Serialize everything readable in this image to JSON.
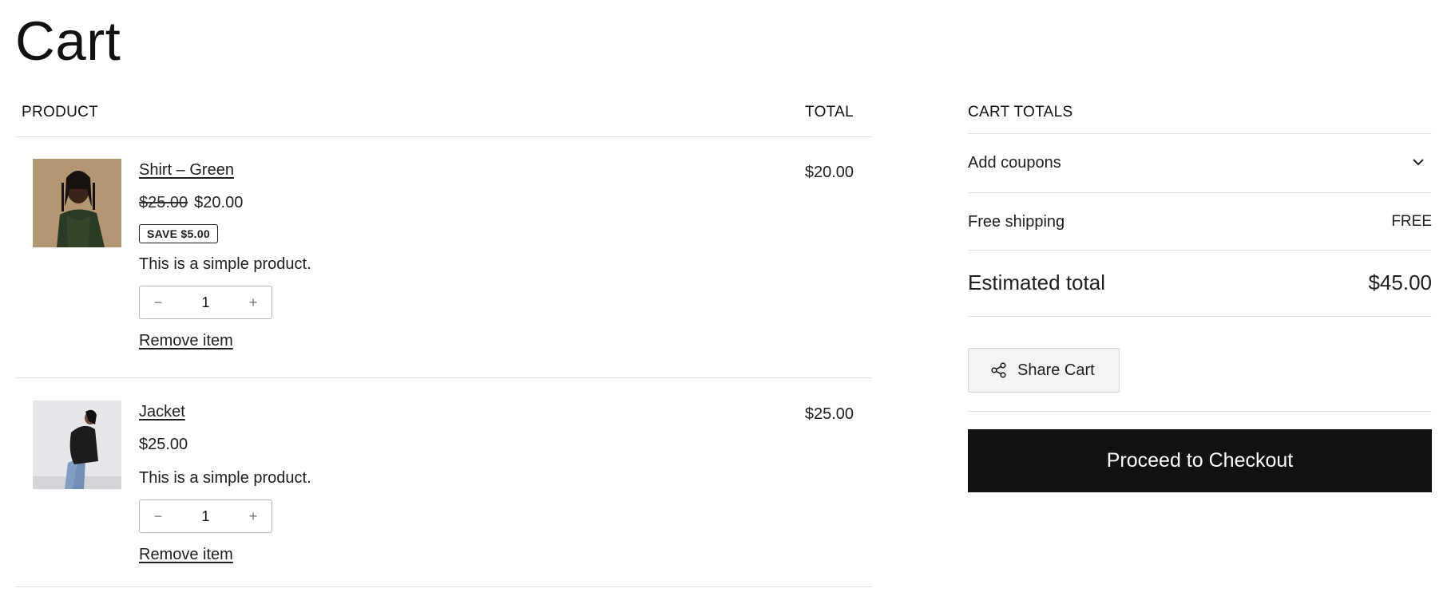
{
  "page": {
    "title": "Cart"
  },
  "table": {
    "header_product": "Product",
    "header_total": "Total"
  },
  "items": [
    {
      "name": "Shirt – Green",
      "regular_price": "$25.00",
      "price": "$20.00",
      "badge": "Save $5.00",
      "description": "This is a simple product.",
      "quantity": "1",
      "remove_label": "Remove item",
      "line_total": "$20.00",
      "thumbnail": "shirt-green-photo"
    },
    {
      "name": "Jacket",
      "price": "$25.00",
      "description": "This is a simple product.",
      "quantity": "1",
      "remove_label": "Remove item",
      "line_total": "$25.00",
      "thumbnail": "jacket-photo"
    }
  ],
  "quantity_controls": {
    "decrease_symbol": "−",
    "increase_symbol": "+"
  },
  "totals": {
    "title": "Cart totals",
    "coupons_label": "Add coupons",
    "shipping_label": "Free shipping",
    "shipping_value": "FREE",
    "estimated_label": "Estimated total",
    "estimated_value": "$45.00",
    "share_label": "Share Cart",
    "checkout_label": "Proceed to Checkout"
  },
  "icons": {
    "coupons_toggle": "chevron-down-icon",
    "share": "share-icon"
  },
  "colors": {
    "checkout_bg": "#111111",
    "checkout_text": "#ffffff",
    "share_bg": "#f4f4f4",
    "divider": "#e0e0e0"
  }
}
